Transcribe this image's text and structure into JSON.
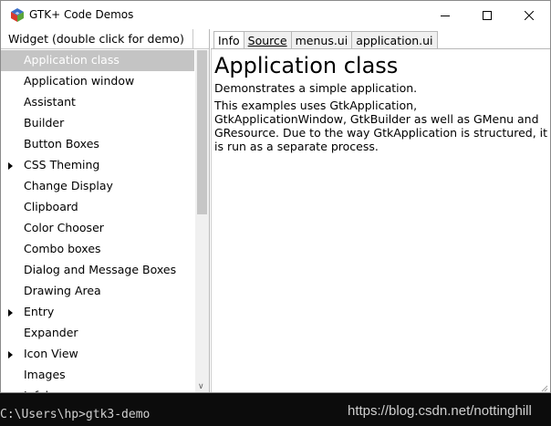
{
  "window": {
    "title": "GTK+ Code Demos",
    "app_icon": "gtk-logo-icon",
    "controls": [
      "minimize-icon",
      "maximize-icon",
      "close-icon"
    ]
  },
  "sidebar": {
    "header": "Widget (double click for demo)",
    "selected": "Application class",
    "items": [
      {
        "label": "Application class",
        "expandable": false
      },
      {
        "label": "Application window",
        "expandable": false
      },
      {
        "label": "Assistant",
        "expandable": false
      },
      {
        "label": "Builder",
        "expandable": false
      },
      {
        "label": "Button Boxes",
        "expandable": false
      },
      {
        "label": "CSS Theming",
        "expandable": true
      },
      {
        "label": "Change Display",
        "expandable": false
      },
      {
        "label": "Clipboard",
        "expandable": false
      },
      {
        "label": "Color Chooser",
        "expandable": false
      },
      {
        "label": "Combo boxes",
        "expandable": false
      },
      {
        "label": "Dialog and Message Boxes",
        "expandable": false
      },
      {
        "label": "Drawing Area",
        "expandable": false
      },
      {
        "label": "Entry",
        "expandable": true
      },
      {
        "label": "Expander",
        "expandable": false
      },
      {
        "label": "Icon View",
        "expandable": true
      },
      {
        "label": "Images",
        "expandable": false
      },
      {
        "label": "Infobar",
        "expandable": false
      }
    ]
  },
  "tabs": [
    {
      "label": "Info",
      "active": true
    },
    {
      "label": "Source",
      "active": false
    },
    {
      "label": "menus.ui",
      "active": false
    },
    {
      "label": "application.ui",
      "active": false
    }
  ],
  "info": {
    "title": "Application class",
    "subtitle": "Demonstrates a simple application.",
    "body": "This examples uses GtkApplication, GtkApplicationWindow, GtkBuilder as well as GMenu and GResource. Due to the way GtkApplication is structured, it is run as a separate process."
  },
  "console": {
    "command": "C:\\Users\\hp>gtk3-demo"
  },
  "watermark": "https://blog.csdn.net/nottinghill",
  "colors": {
    "selection": "#c4c4c4",
    "console_bg": "#0c0c0c",
    "gtk_red": "#d83a2e",
    "gtk_green": "#5aa53a",
    "gtk_blue": "#3a6ec8"
  }
}
